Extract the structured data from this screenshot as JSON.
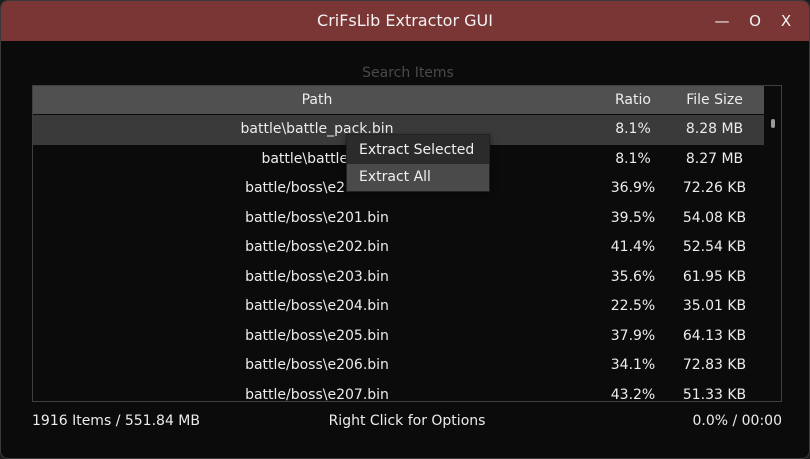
{
  "window": {
    "title": "CriFsLib Extractor GUI",
    "minimize_glyph": "—",
    "maximize_glyph": "O",
    "close_glyph": "X"
  },
  "search": {
    "placeholder": "Search Items",
    "value": ""
  },
  "table": {
    "columns": [
      "Path",
      "Ratio",
      "File Size"
    ],
    "rows": [
      {
        "path": "battle\\battle_pack.bin",
        "ratio": "8.1%",
        "size": "8.28 MB"
      },
      {
        "path": "battle\\battle_pa",
        "ratio": "8.1%",
        "size": "8.27 MB"
      },
      {
        "path": "battle/boss\\e200.bin",
        "ratio": "36.9%",
        "size": "72.26 KB"
      },
      {
        "path": "battle/boss\\e201.bin",
        "ratio": "39.5%",
        "size": "54.08 KB"
      },
      {
        "path": "battle/boss\\e202.bin",
        "ratio": "41.4%",
        "size": "52.54 KB"
      },
      {
        "path": "battle/boss\\e203.bin",
        "ratio": "35.6%",
        "size": "61.95 KB"
      },
      {
        "path": "battle/boss\\e204.bin",
        "ratio": "22.5%",
        "size": "35.01 KB"
      },
      {
        "path": "battle/boss\\e205.bin",
        "ratio": "37.9%",
        "size": "64.13 KB"
      },
      {
        "path": "battle/boss\\e206.bin",
        "ratio": "34.1%",
        "size": "72.83 KB"
      },
      {
        "path": "battle/boss\\e207.bin",
        "ratio": "43.2%",
        "size": "51.33 KB"
      }
    ]
  },
  "context_menu": {
    "items": [
      "Extract Selected",
      "Extract All"
    ]
  },
  "status": {
    "summary": "1916 Items / 551.84 MB",
    "hint": "Right Click for Options",
    "progress": "0.0% / 00:00"
  },
  "colors": {
    "titlebar": "#7a3535",
    "background": "#0b0b0b",
    "header": "#505050",
    "selected_row": "#3a3a3a",
    "menu": "#2b2b2b",
    "menu_highlight": "#4a4a4a"
  }
}
